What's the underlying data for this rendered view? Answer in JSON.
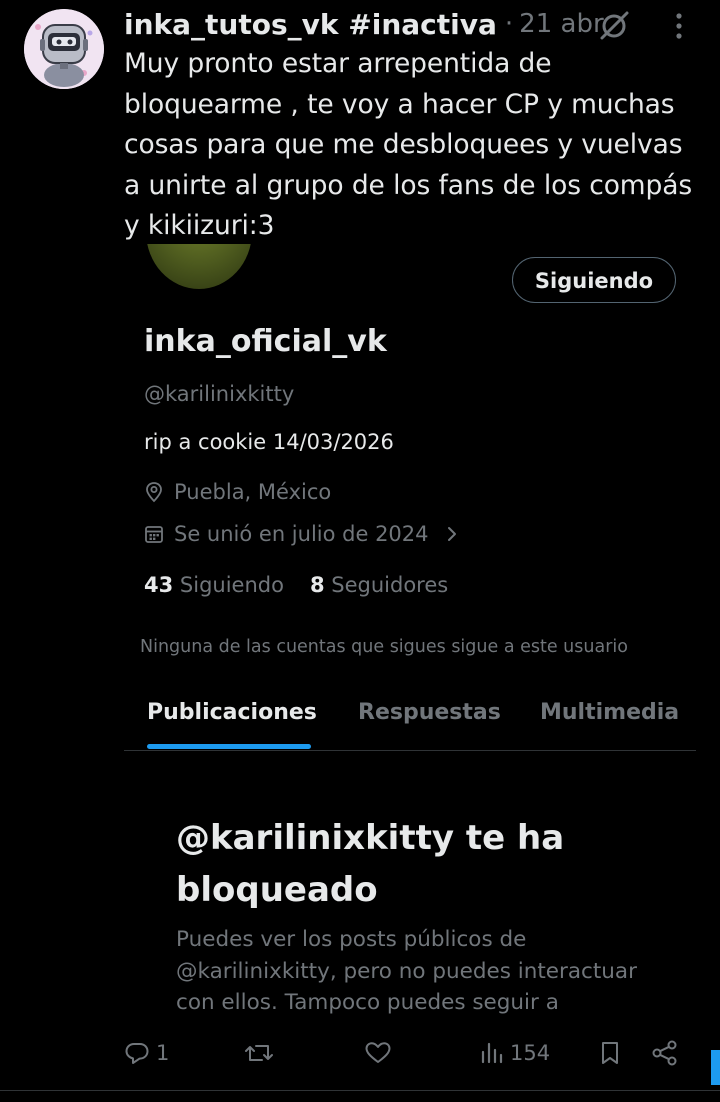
{
  "post": {
    "author": "inka_tutos_vk #inactiva",
    "separator": "·",
    "time": "21 abr",
    "text": "Muy pronto estar arrepentida de bloquearme , te voy a hacer CP y muchas cosas para que me desbloquees y vuelvas a unirte al grupo de los fans de los compás y kikiizuri:3"
  },
  "profile": {
    "follow_label": "Siguiendo",
    "display_name": "inka_oficial_vk",
    "handle": "@karilinixkitty",
    "bio": "rip a cookie 14/03/2026",
    "location": "Puebla, México",
    "joined": "Se unió en julio de 2024",
    "following_count": "43",
    "following_label": "Siguiendo",
    "followers_count": "8",
    "followers_label": "Seguidores",
    "mutual_note": "Ninguna de las cuentas que sigues sigue a este usuario"
  },
  "tabs": [
    {
      "label": "Publicaciones",
      "active": true
    },
    {
      "label": "Respuestas",
      "active": false
    },
    {
      "label": "Multimedia",
      "active": false
    }
  ],
  "blocked": {
    "title": "@karilinixkitty te ha bloqueado",
    "description": "Puedes ver los posts públicos de @karilinixkitty, pero no puedes interactuar con ellos. Tampoco puedes seguir a"
  },
  "actions": {
    "replies": "1",
    "views": "154"
  },
  "colors": {
    "background": "#000000",
    "text_primary": "#e7e9ea",
    "text_secondary": "#71767b",
    "accent": "#1d9bf0",
    "divider": "#2f3336"
  }
}
